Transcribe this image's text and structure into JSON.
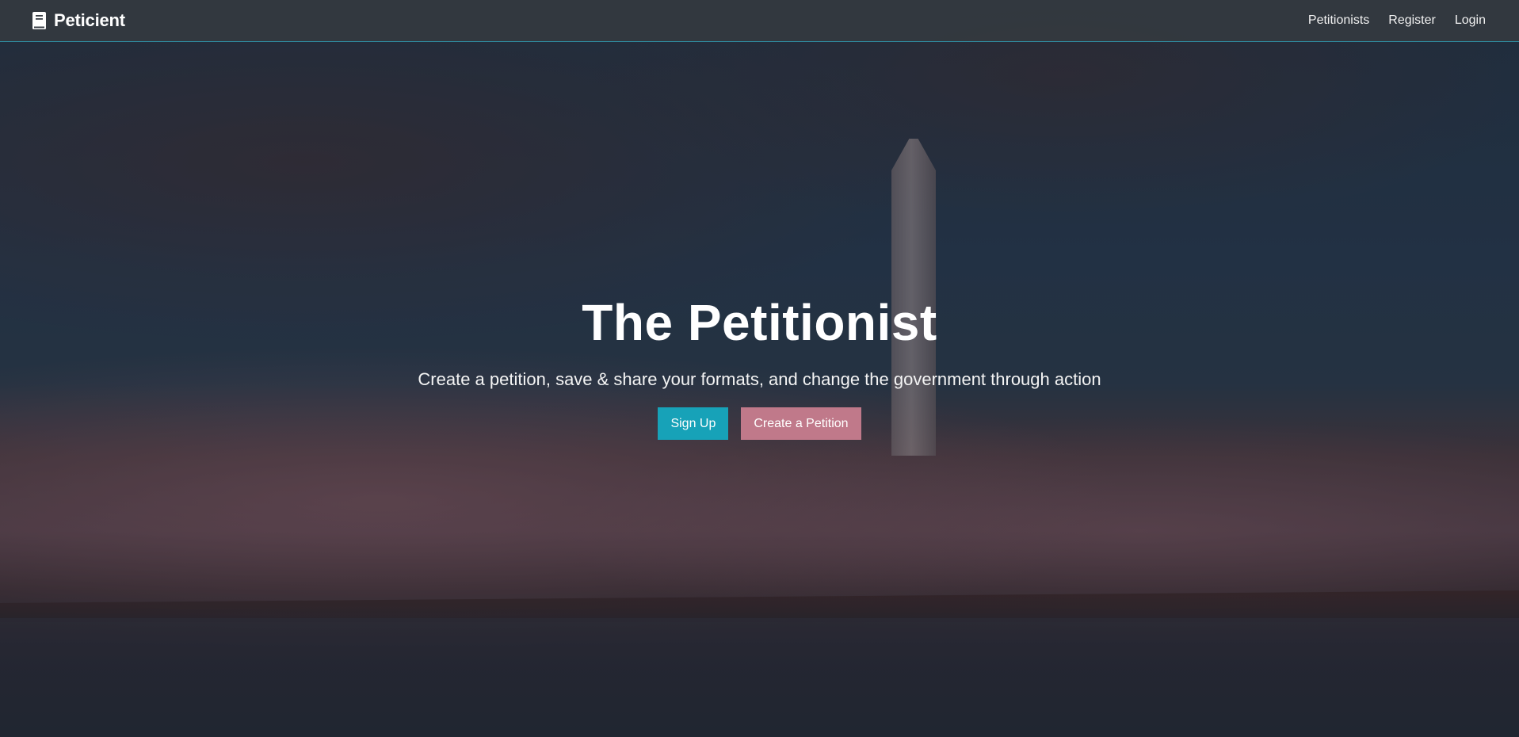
{
  "navbar": {
    "brand": "Peticient",
    "links": [
      "Petitionists",
      "Register",
      "Login"
    ]
  },
  "hero": {
    "title": "The Petitionist",
    "subtitle": "Create a petition, save & share your formats, and change the government through action",
    "signup_label": "Sign Up",
    "create_label": "Create a Petition"
  },
  "icons": {
    "brand_icon": "book-icon"
  },
  "colors": {
    "signup_button": "#17a2b8",
    "create_button": "#c0798a",
    "navbar_border": "#2f8fa3"
  }
}
